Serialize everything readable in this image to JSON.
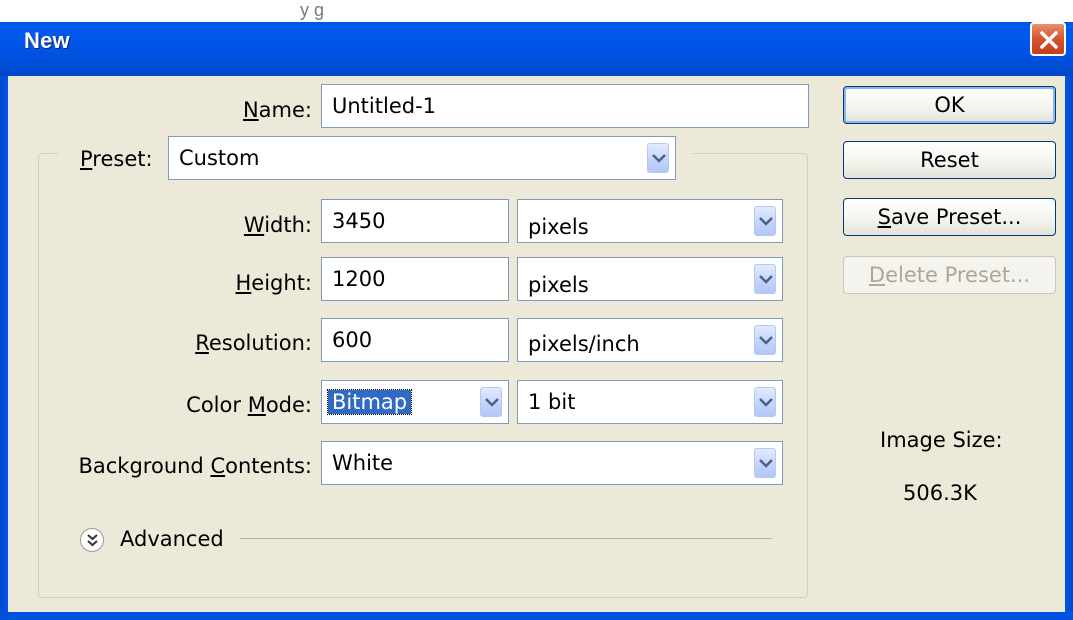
{
  "background_text": "y                  g",
  "window": {
    "title": "New"
  },
  "colors": {
    "titlebar": "#0058EE",
    "face": "#ECE9D8",
    "selection": "#316AC5",
    "close": "#D6532C"
  },
  "form": {
    "name_label": "Name:",
    "name_value": "Untitled-1",
    "preset_label": "Preset:",
    "preset_value": "Custom",
    "width_label": "Width:",
    "width_value": "3450",
    "width_unit": "pixels",
    "height_label": "Height:",
    "height_value": "1200",
    "height_unit": "pixels",
    "resolution_label": "Resolution:",
    "resolution_value": "600",
    "resolution_unit": "pixels/inch",
    "color_mode_label": "Color Mode:",
    "color_mode_value": "Bitmap",
    "bit_depth_value": "1 bit",
    "background_label": "Background Contents:",
    "background_value": "White",
    "advanced_label": "Advanced"
  },
  "buttons": {
    "ok": "OK",
    "reset": "Reset",
    "save_preset": "Save Preset...",
    "delete_preset": "Delete Preset..."
  },
  "image_size": {
    "label": "Image Size:",
    "value": "506.3K"
  },
  "icons": [
    "close-icon",
    "dropdown-arrow-icon",
    "expand-chevron-icon"
  ]
}
